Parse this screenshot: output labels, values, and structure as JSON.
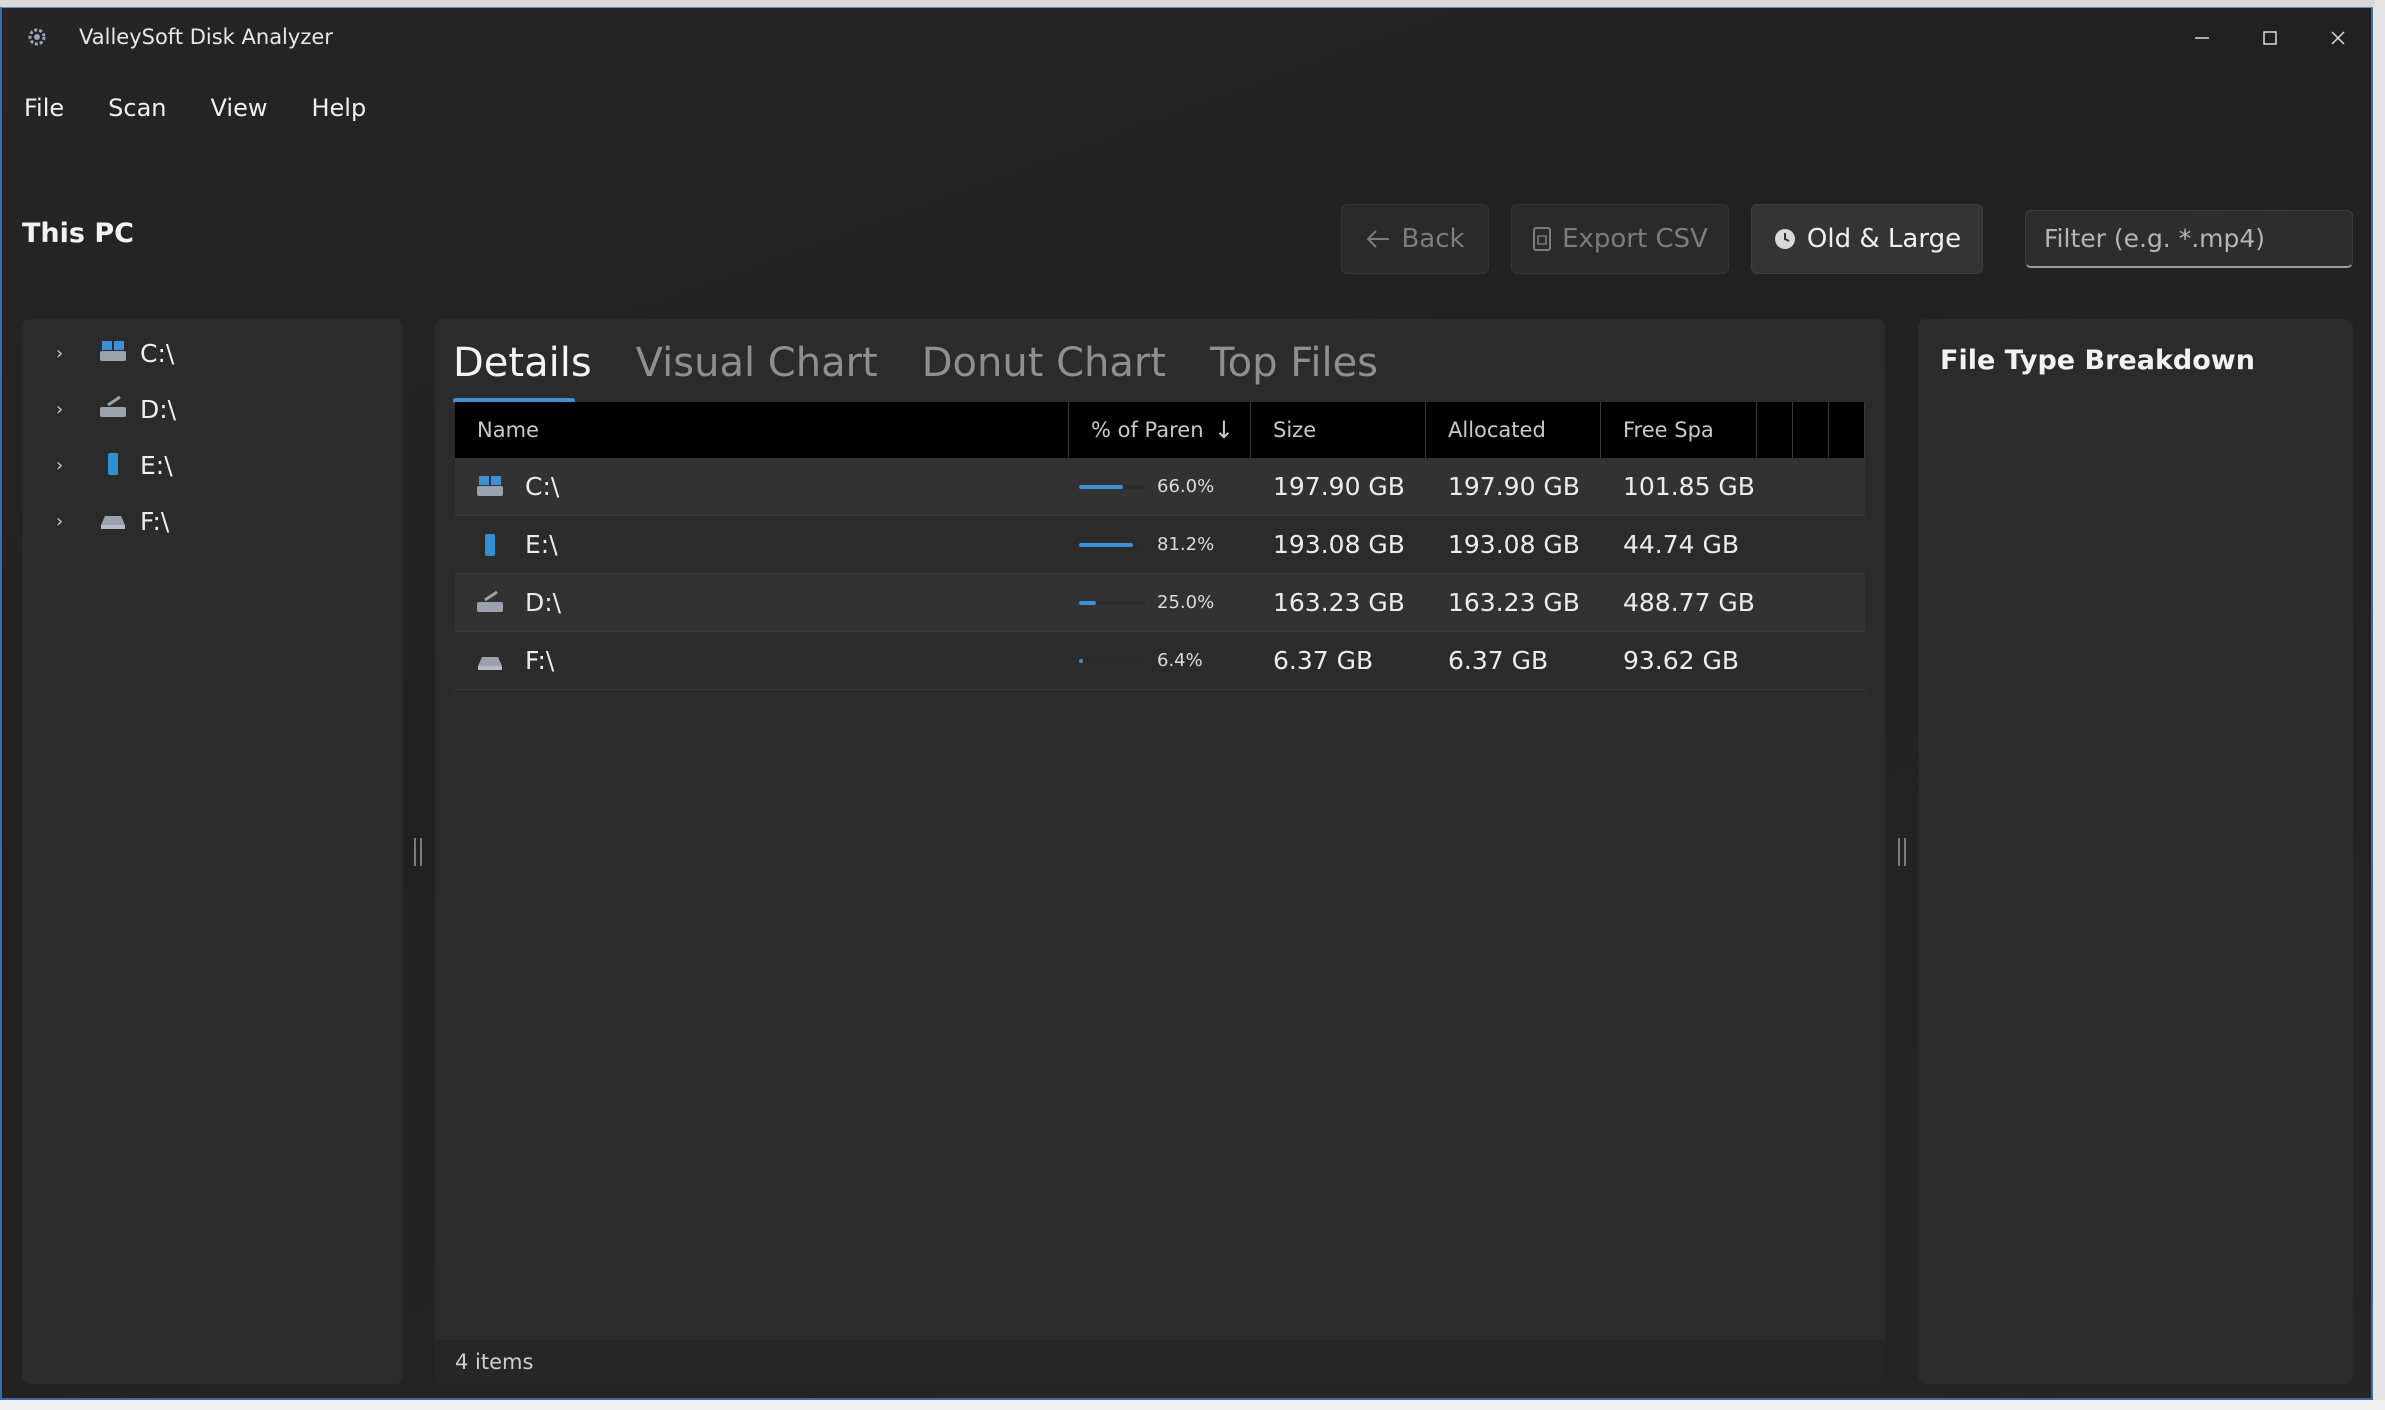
{
  "window": {
    "title": "ValleySoft Disk Analyzer"
  },
  "menu": [
    "File",
    "Scan",
    "View",
    "Help"
  ],
  "location": "This PC",
  "toolbar": {
    "back_label": "Back",
    "export_label": "Export CSV",
    "oldlarge_label": "Old & Large",
    "filter_placeholder": "Filter (e.g. *.mp4)"
  },
  "tree": [
    {
      "label": "C:\\",
      "icon": "system-drive-icon"
    },
    {
      "label": "D:\\",
      "icon": "disk-drive-icon"
    },
    {
      "label": "E:\\",
      "icon": "usb-drive-icon"
    },
    {
      "label": "F:\\",
      "icon": "removable-drive-icon"
    }
  ],
  "tabs": [
    "Details",
    "Visual Chart",
    "Donut Chart",
    "Top Files"
  ],
  "grid": {
    "columns": [
      "Name",
      "% of Paren",
      "Size",
      "Allocated",
      "Free Spa"
    ],
    "rows": [
      {
        "name": "C:\\",
        "pct": "66.0%",
        "pct_value": 66.0,
        "size": "197.90 GB",
        "allocated": "197.90 GB",
        "free": "101.85 GB",
        "icon": "system-drive-icon"
      },
      {
        "name": "E:\\",
        "pct": "81.2%",
        "pct_value": 81.2,
        "size": "193.08 GB",
        "allocated": "193.08 GB",
        "free": "44.74 GB",
        "icon": "usb-drive-icon"
      },
      {
        "name": "D:\\",
        "pct": "25.0%",
        "pct_value": 25.0,
        "size": "163.23 GB",
        "allocated": "163.23 GB",
        "free": "488.77 GB",
        "icon": "disk-drive-icon"
      },
      {
        "name": "F:\\",
        "pct": "6.4%",
        "pct_value": 6.4,
        "size": "6.37 GB",
        "allocated": "6.37 GB",
        "free": "93.62 GB",
        "icon": "removable-drive-icon"
      }
    ]
  },
  "status": "4 items",
  "right_panel": {
    "title": "File Type Breakdown"
  },
  "colors": {
    "accent": "#3d8fd8",
    "background": "#232323",
    "panel": "#2b2b2b"
  }
}
